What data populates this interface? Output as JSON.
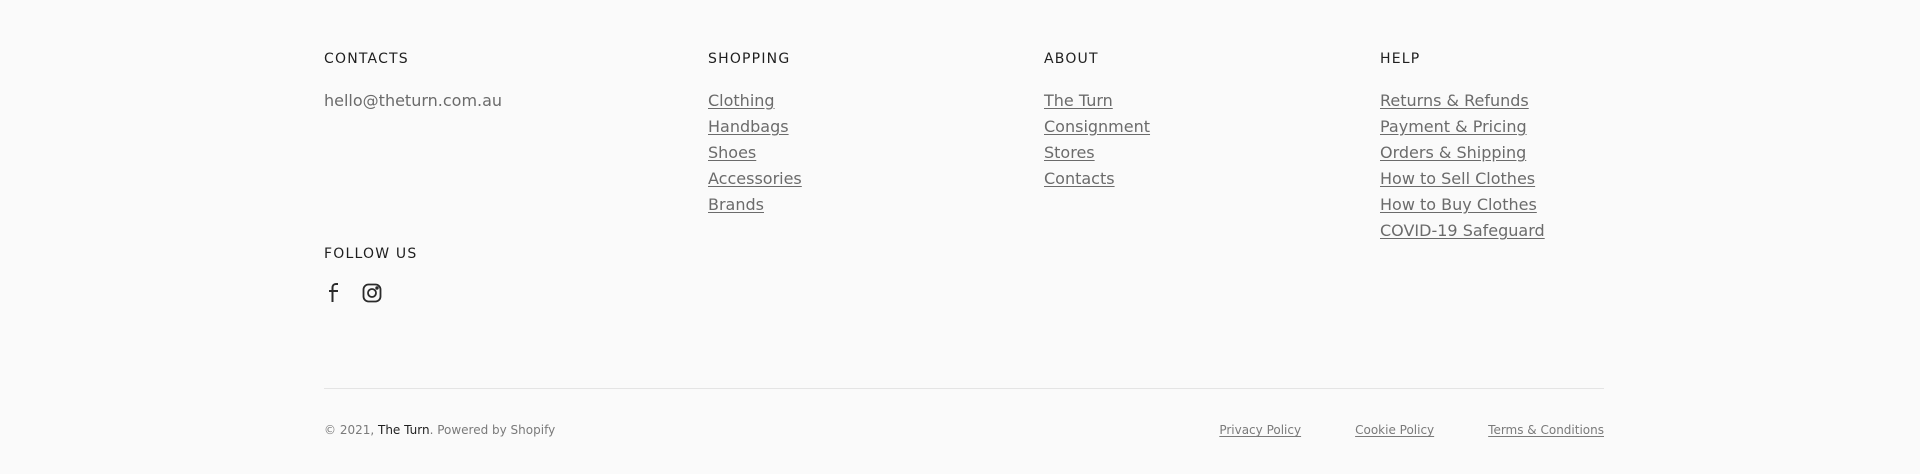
{
  "contacts": {
    "title": "CONTACTS",
    "email": "hello@theturn.com.au"
  },
  "follow": {
    "title": "FOLLOW US",
    "icons": [
      "facebook-icon",
      "instagram-icon"
    ]
  },
  "shopping": {
    "title": "SHOPPING",
    "links": [
      "Clothing",
      "Handbags",
      "Shoes",
      "Accessories",
      "Brands"
    ]
  },
  "about": {
    "title": "ABOUT",
    "links": [
      "The Turn",
      "Consignment",
      "Stores",
      "Contacts"
    ]
  },
  "help": {
    "title": "HELP",
    "links": [
      "Returns & Refunds",
      "Payment & Pricing",
      "Orders & Shipping",
      "How to Sell Clothes",
      "How to Buy Clothes",
      "COVID-19 Safeguard"
    ]
  },
  "bottom": {
    "copyright_prefix": "© 2021, ",
    "brand": "The Turn",
    "powered": ". Powered by Shopify",
    "legal": [
      "Privacy Policy",
      "Cookie Policy",
      "Terms & Conditions"
    ]
  },
  "colors": {
    "background": "#fafafa",
    "heading": "#1f1f1f",
    "link": "#6b6b6b"
  }
}
